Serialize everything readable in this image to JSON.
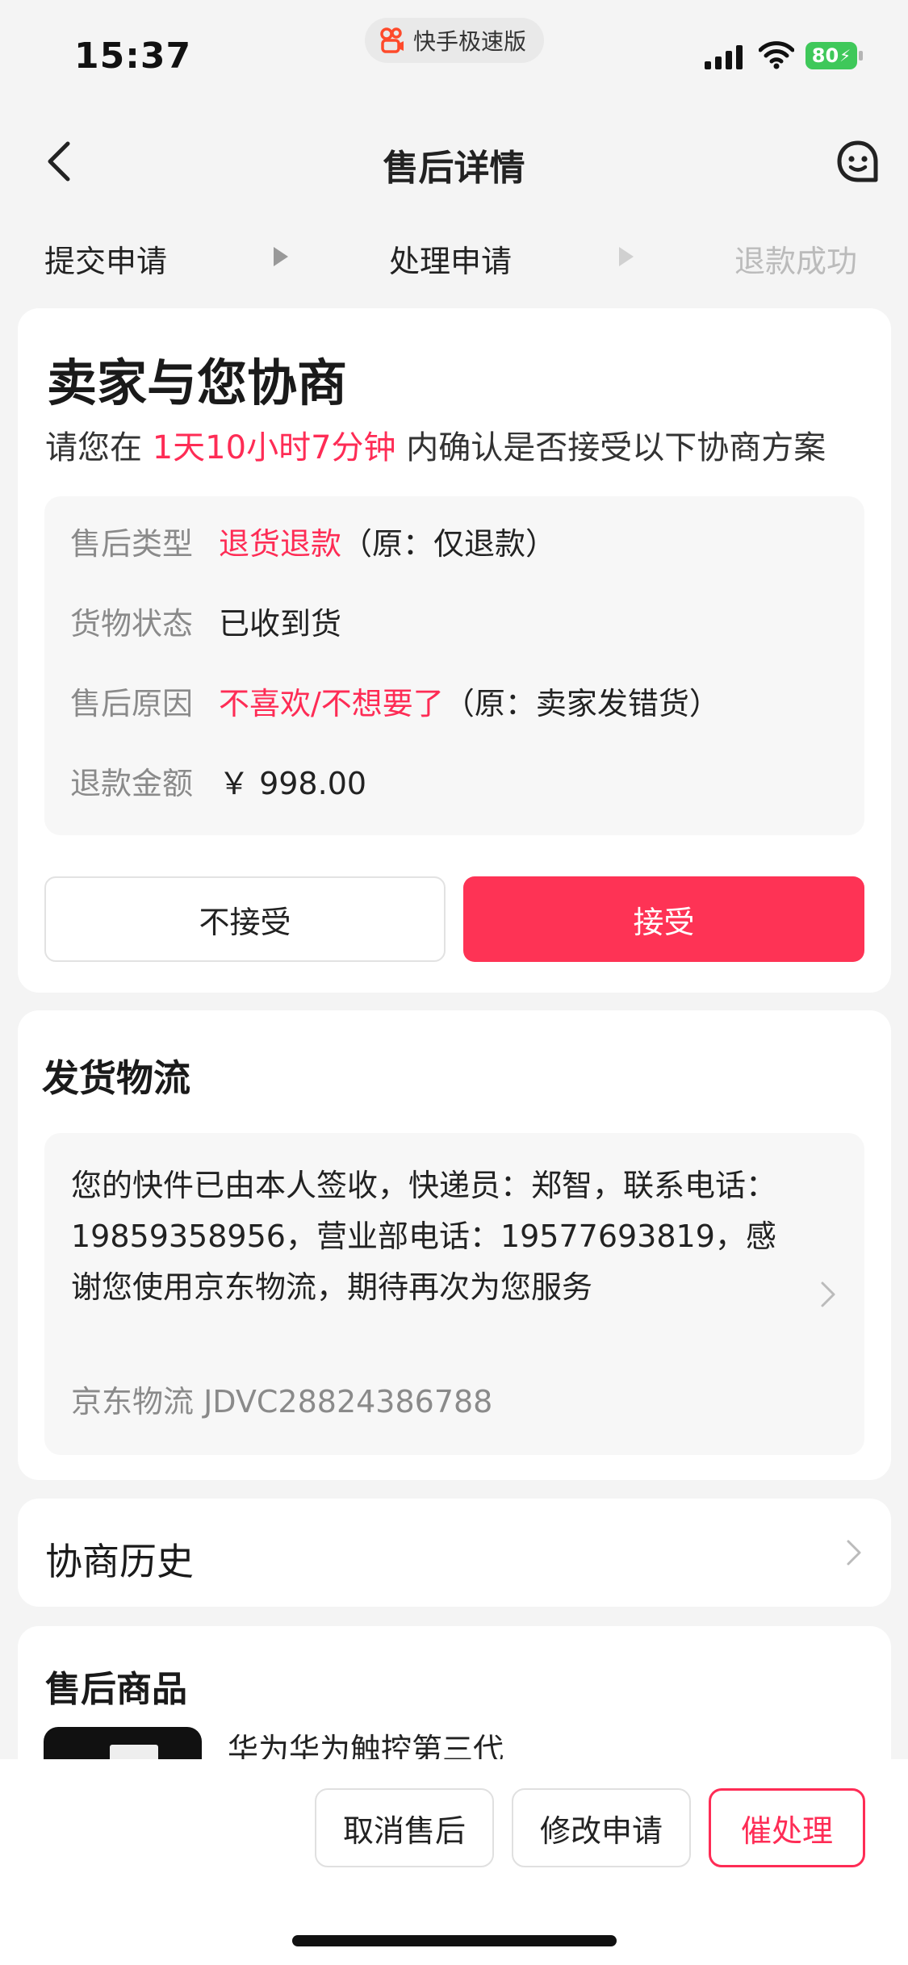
{
  "status_bar": {
    "time": "15:37",
    "app_name": "快手极速版",
    "battery": "80",
    "icons": [
      "signal-icon",
      "wifi-icon",
      "battery-charging-icon"
    ]
  },
  "nav": {
    "title": "售后详情",
    "icons": [
      "back-arrow-icon",
      "customer-service-icon"
    ]
  },
  "steps": [
    {
      "label": "提交申请",
      "state": "done"
    },
    {
      "label": "处理申请",
      "state": "current"
    },
    {
      "label": "退款成功",
      "state": "pending"
    }
  ],
  "negotiation": {
    "title": "卖家与您协商",
    "subtitle_prefix": "请您在",
    "deadline": "1天10小时7分钟",
    "subtitle_suffix": "内确认是否接受以下协商方案",
    "rows": [
      {
        "key": "售后类型",
        "value": "退货退款",
        "value_highlight": true,
        "original": "（原：仅退款）"
      },
      {
        "key": "货物状态",
        "value": "已收到货",
        "value_highlight": false,
        "original": ""
      },
      {
        "key": "售后原因",
        "value": "不喜欢/不想要了",
        "value_highlight": true,
        "original": "（原：卖家发错货）"
      },
      {
        "key": "退款金额",
        "value": "￥ 998.00",
        "value_highlight": false,
        "original": ""
      }
    ],
    "reject_label": "不接受",
    "accept_label": "接受"
  },
  "logistics": {
    "title": "发货物流",
    "message": "您的快件已由本人签收，快递员：郑智，联系电话：19859358956，营业部电话：19577693819，感谢您使用京东物流，期待再次为您服务",
    "carrier_tracking": "京东物流 JDVC28824386788"
  },
  "history": {
    "label": "协商历史"
  },
  "goods": {
    "title": "售后商品",
    "name": "华为华为触控第三代"
  },
  "bottom_bar": {
    "cancel_label": "取消售后",
    "modify_label": "修改申请",
    "urge_label": "催处理"
  },
  "colors": {
    "accent": "#fe2c55",
    "accept_button": "#fe3355",
    "battery": "#3fc85a",
    "background": "#f4f4f4"
  }
}
